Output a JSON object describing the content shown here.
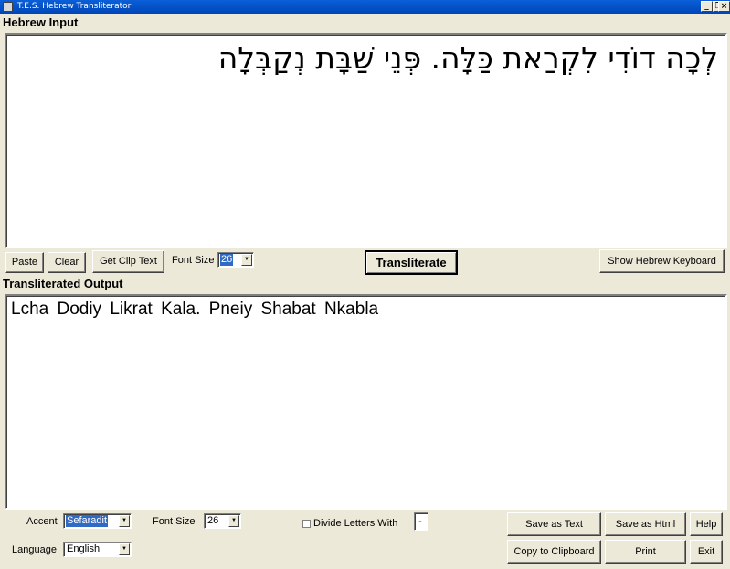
{
  "window": {
    "title": "T.E.S. Hebrew Transliterator",
    "controls": {
      "minimize": "_",
      "restore": "❐",
      "close": "×"
    }
  },
  "hebrew_input": {
    "label": "Hebrew Input",
    "text": "לְכָה דוֹדִי לִקְרַאת כַּלָּה. פְּנֵי שַׁבָּת נְקַבְּלָה"
  },
  "input_toolbar": {
    "paste": "Paste",
    "clear": "Clear",
    "get_clip_text": "Get Clip Text",
    "font_size_label": "Font Size",
    "font_size_value": "26",
    "transliterate": "Transliterate",
    "show_keyboard": "Show Hebrew Keyboard"
  },
  "output": {
    "label": "Transliterated Output",
    "text": "Lcha Dodiy Likrat Kala. Pneiy Shabat Nkabla"
  },
  "options": {
    "accent_label": "Accent",
    "accent_value": "Sefaradit",
    "font_size_label": "Font Size",
    "font_size_value": "26",
    "divide_label": "Divide Letters With",
    "divide_value": "-",
    "language_label": "Language",
    "language_value": "English"
  },
  "actions": {
    "save_text": "Save as Text",
    "save_html": "Save as Html",
    "help": "Help",
    "copy_clipboard": "Copy to Clipboard",
    "print": "Print",
    "exit": "Exit"
  },
  "icons": {
    "dropdown": "▼",
    "app": "app-icon"
  }
}
